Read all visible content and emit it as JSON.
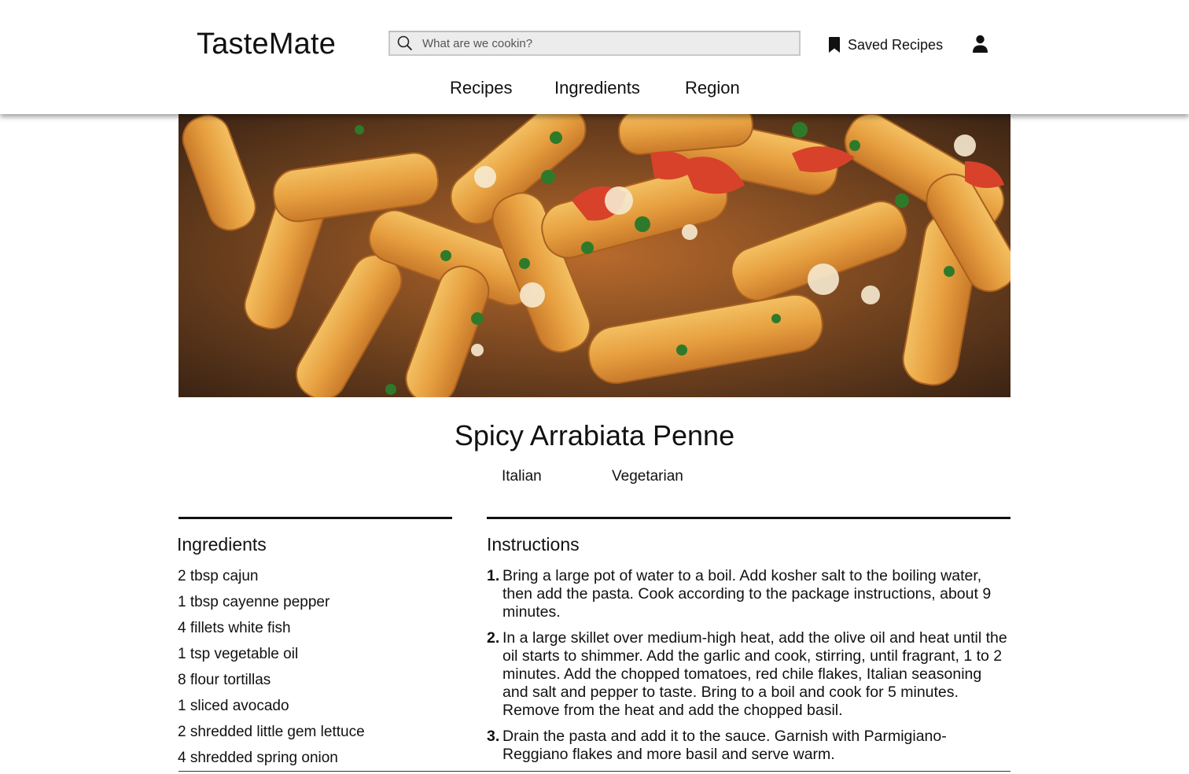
{
  "header": {
    "logo": "TasteMate",
    "search_placeholder": "What are we cookin?",
    "saved_label": "Saved Recipes",
    "nav": [
      "Recipes",
      "Ingredients",
      "Region"
    ]
  },
  "recipe": {
    "title": "Spicy Arrabiata Penne",
    "tags": [
      "Italian",
      "Vegetarian"
    ],
    "ingredients_heading": "Ingredients",
    "instructions_heading": "Instructions",
    "ingredients": [
      "2 tbsp cajun",
      "1 tbsp cayenne pepper",
      "4 fillets white fish",
      "1 tsp vegetable oil",
      "8 flour tortillas",
      "1 sliced avocado",
      "2 shredded little gem lettuce",
      "4 shredded spring onion"
    ],
    "instructions": [
      {
        "num": "1.",
        "text": "Bring a large pot of water to a boil. Add kosher salt to the boiling water, then add the pasta. Cook according to the package instructions, about 9 minutes."
      },
      {
        "num": "2.",
        "text": "In a large skillet over medium-high heat, add the olive oil and heat until the oil starts to shimmer. Add the garlic and cook, stirring, until fragrant, 1 to 2 minutes. Add the chopped tomatoes, red chile flakes, Italian seasoning and salt and pepper to taste. Bring to a boil and cook for 5 minutes. Remove from the heat and add the chopped basil."
      },
      {
        "num": "3.",
        "text": "Drain the pasta and add it to the sauce. Garnish with Parmigiano-Reggiano flakes and more basil and serve warm."
      }
    ]
  },
  "icons": {
    "search": "search-icon",
    "saved": "bookmark-icon",
    "user": "user-icon"
  }
}
